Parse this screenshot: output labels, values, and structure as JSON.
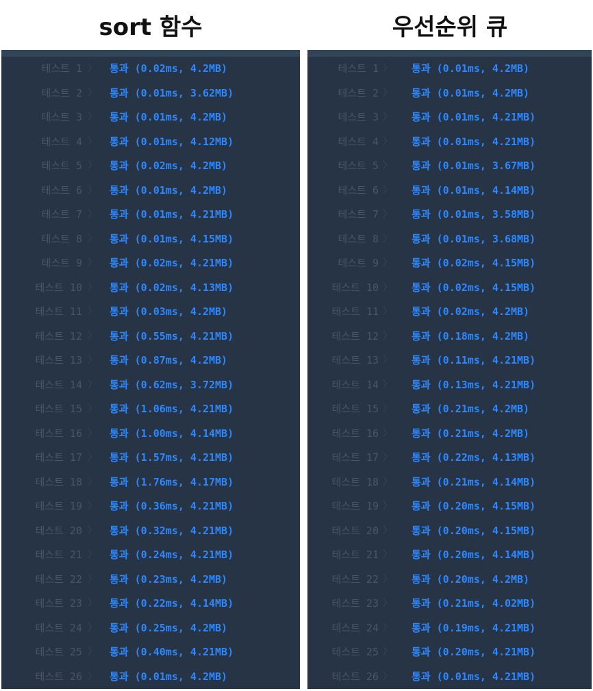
{
  "headings": {
    "left": "sort 함수",
    "right": "우선순위 큐"
  },
  "separator_glyph": "〉",
  "colors": {
    "panel_bg": "#263445",
    "label_gray": "#47566a",
    "pass_blue": "#2d88ff"
  },
  "left_results": [
    {
      "label": "테스트 1",
      "result": "통과 (0.02ms, 4.2MB)"
    },
    {
      "label": "테스트 2",
      "result": "통과 (0.01ms, 3.62MB)"
    },
    {
      "label": "테스트 3",
      "result": "통과 (0.01ms, 4.2MB)"
    },
    {
      "label": "테스트 4",
      "result": "통과 (0.01ms, 4.12MB)"
    },
    {
      "label": "테스트 5",
      "result": "통과 (0.02ms, 4.2MB)"
    },
    {
      "label": "테스트 6",
      "result": "통과 (0.01ms, 4.2MB)"
    },
    {
      "label": "테스트 7",
      "result": "통과 (0.01ms, 4.21MB)"
    },
    {
      "label": "테스트 8",
      "result": "통과 (0.01ms, 4.15MB)"
    },
    {
      "label": "테스트 9",
      "result": "통과 (0.02ms, 4.21MB)"
    },
    {
      "label": "테스트 10",
      "result": "통과 (0.02ms, 4.13MB)"
    },
    {
      "label": "테스트 11",
      "result": "통과 (0.03ms, 4.2MB)"
    },
    {
      "label": "테스트 12",
      "result": "통과 (0.55ms, 4.21MB)"
    },
    {
      "label": "테스트 13",
      "result": "통과 (0.87ms, 4.2MB)"
    },
    {
      "label": "테스트 14",
      "result": "통과 (0.62ms, 3.72MB)"
    },
    {
      "label": "테스트 15",
      "result": "통과 (1.06ms, 4.21MB)"
    },
    {
      "label": "테스트 16",
      "result": "통과 (1.00ms, 4.14MB)"
    },
    {
      "label": "테스트 17",
      "result": "통과 (1.57ms, 4.21MB)"
    },
    {
      "label": "테스트 18",
      "result": "통과 (1.76ms, 4.17MB)"
    },
    {
      "label": "테스트 19",
      "result": "통과 (0.36ms, 4.21MB)"
    },
    {
      "label": "테스트 20",
      "result": "통과 (0.32ms, 4.21MB)"
    },
    {
      "label": "테스트 21",
      "result": "통과 (0.24ms, 4.21MB)"
    },
    {
      "label": "테스트 22",
      "result": "통과 (0.23ms, 4.2MB)"
    },
    {
      "label": "테스트 23",
      "result": "통과 (0.22ms, 4.14MB)"
    },
    {
      "label": "테스트 24",
      "result": "통과 (0.25ms, 4.2MB)"
    },
    {
      "label": "테스트 25",
      "result": "통과 (0.40ms, 4.21MB)"
    },
    {
      "label": "테스트 26",
      "result": "통과 (0.01ms, 4.2MB)"
    }
  ],
  "right_results": [
    {
      "label": "테스트 1",
      "result": "통과 (0.01ms, 4.2MB)"
    },
    {
      "label": "테스트 2",
      "result": "통과 (0.01ms, 4.2MB)"
    },
    {
      "label": "테스트 3",
      "result": "통과 (0.01ms, 4.21MB)"
    },
    {
      "label": "테스트 4",
      "result": "통과 (0.01ms, 4.21MB)"
    },
    {
      "label": "테스트 5",
      "result": "통과 (0.01ms, 3.67MB)"
    },
    {
      "label": "테스트 6",
      "result": "통과 (0.01ms, 4.14MB)"
    },
    {
      "label": "테스트 7",
      "result": "통과 (0.01ms, 3.58MB)"
    },
    {
      "label": "테스트 8",
      "result": "통과 (0.01ms, 3.68MB)"
    },
    {
      "label": "테스트 9",
      "result": "통과 (0.02ms, 4.15MB)"
    },
    {
      "label": "테스트 10",
      "result": "통과 (0.02ms, 4.15MB)"
    },
    {
      "label": "테스트 11",
      "result": "통과 (0.02ms, 4.2MB)"
    },
    {
      "label": "테스트 12",
      "result": "통과 (0.18ms, 4.2MB)"
    },
    {
      "label": "테스트 13",
      "result": "통과 (0.11ms, 4.21MB)"
    },
    {
      "label": "테스트 14",
      "result": "통과 (0.13ms, 4.21MB)"
    },
    {
      "label": "테스트 15",
      "result": "통과 (0.21ms, 4.2MB)"
    },
    {
      "label": "테스트 16",
      "result": "통과 (0.21ms, 4.2MB)"
    },
    {
      "label": "테스트 17",
      "result": "통과 (0.22ms, 4.13MB)"
    },
    {
      "label": "테스트 18",
      "result": "통과 (0.21ms, 4.14MB)"
    },
    {
      "label": "테스트 19",
      "result": "통과 (0.20ms, 4.15MB)"
    },
    {
      "label": "테스트 20",
      "result": "통과 (0.20ms, 4.15MB)"
    },
    {
      "label": "테스트 21",
      "result": "통과 (0.20ms, 4.14MB)"
    },
    {
      "label": "테스트 22",
      "result": "통과 (0.20ms, 4.2MB)"
    },
    {
      "label": "테스트 23",
      "result": "통과 (0.21ms, 4.02MB)"
    },
    {
      "label": "테스트 24",
      "result": "통과 (0.19ms, 4.21MB)"
    },
    {
      "label": "테스트 25",
      "result": "통과 (0.20ms, 4.21MB)"
    },
    {
      "label": "테스트 26",
      "result": "통과 (0.01ms, 4.21MB)"
    }
  ]
}
